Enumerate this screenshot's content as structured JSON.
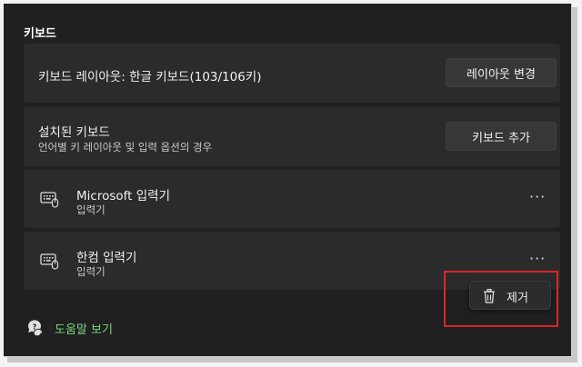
{
  "section": {
    "title": "키보드"
  },
  "layout_card": {
    "label": "키보드 레이아웃: 한글 키보드(103/106키)",
    "button": "레이아웃 변경"
  },
  "installed_card": {
    "title": "설치된 키보드",
    "subtitle": "언어별 키 레이아웃 및 입력 옵션의 경우",
    "button": "키보드 추가"
  },
  "ime_items": [
    {
      "name": "Microsoft 입력기",
      "type": "입력기",
      "more": "···",
      "icon": "keyboard-icon"
    },
    {
      "name": "한컴 입력기",
      "type": "입력기",
      "more": "···",
      "icon": "keyboard-icon"
    }
  ],
  "context_menu": {
    "item": "제거",
    "icon": "trash-icon"
  },
  "help": {
    "label": "도움말 보기",
    "icon": "help-chat-icon"
  },
  "colors": {
    "background": "#202020",
    "card": "#2b2b2b",
    "button": "#373737",
    "link": "#79d77e",
    "highlight": "#d9262a"
  }
}
